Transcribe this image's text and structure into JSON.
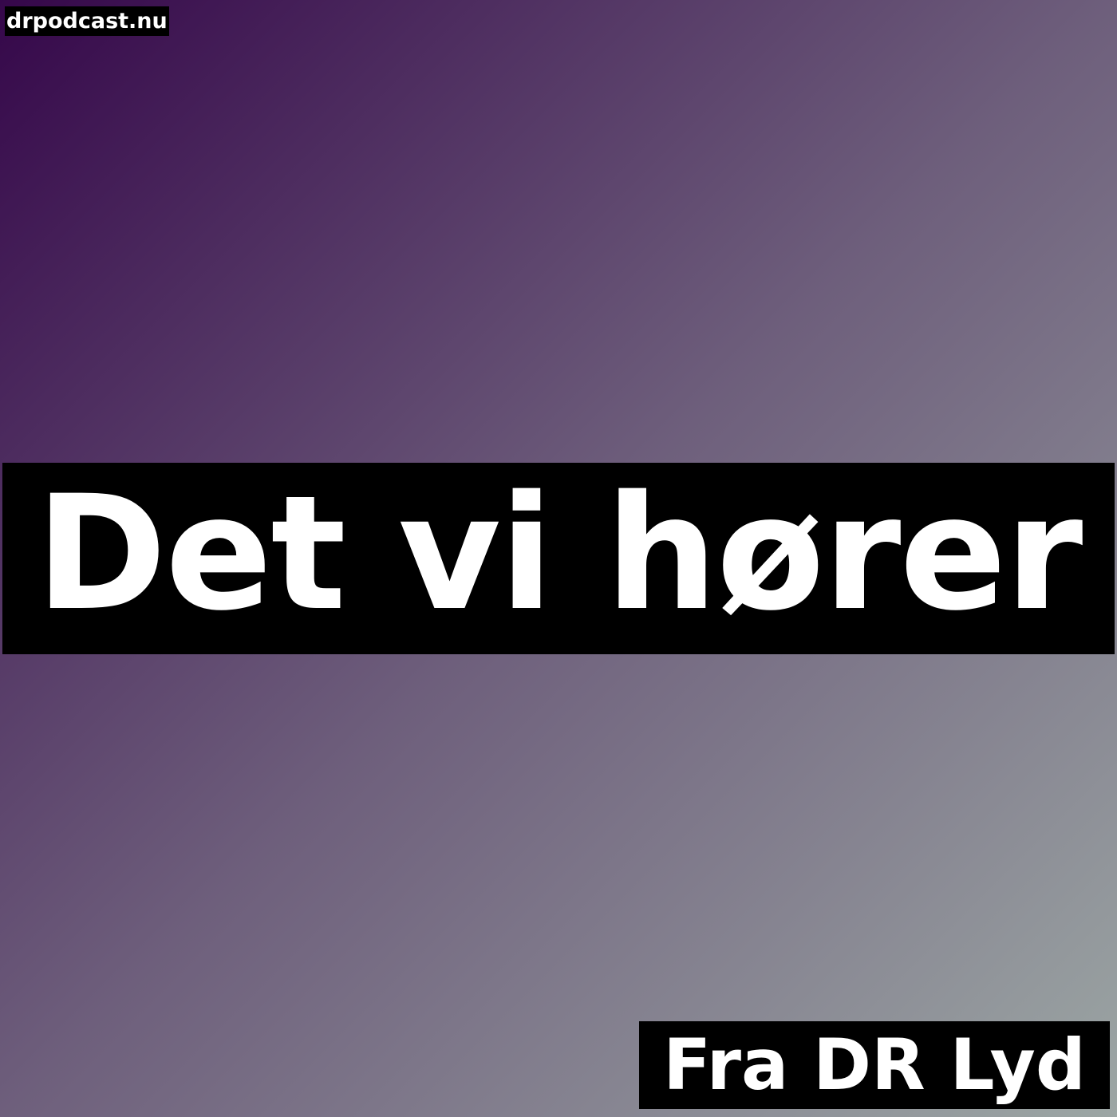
{
  "cover": {
    "site": "drpodcast.nu",
    "title": "Det vi hører",
    "source": "Fra DR Lyd"
  },
  "colors": {
    "gradient_start": "#35074a",
    "gradient_end": "#9ca6a4",
    "label_background": "#000000",
    "label_text": "#ffffff"
  }
}
